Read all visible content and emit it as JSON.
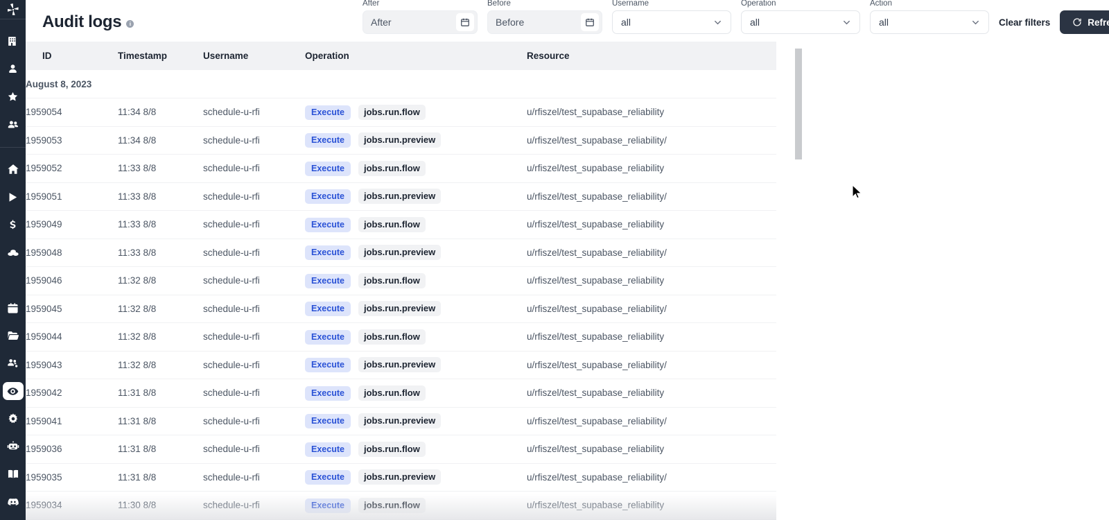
{
  "sidebar": {
    "logo": {
      "icon": "windmill-logo-icon",
      "name": "Windmill"
    },
    "top_items": [
      {
        "icon": "building-icon",
        "label": "Workspace"
      },
      {
        "icon": "person-icon",
        "label": "User"
      },
      {
        "icon": "star-icon",
        "label": "Favorites"
      },
      {
        "icon": "users-group-icon",
        "label": "Groups"
      }
    ],
    "main_items": [
      {
        "icon": "home-icon",
        "label": "Home"
      },
      {
        "icon": "play-icon",
        "label": "Runs"
      },
      {
        "icon": "dollar-icon",
        "label": "Usage"
      },
      {
        "icon": "variables-icon",
        "label": "Variables"
      }
    ],
    "lower_items": [
      {
        "icon": "calendar-icon",
        "label": "Schedules"
      },
      {
        "icon": "folder-icon",
        "label": "Folders"
      },
      {
        "icon": "user-settings-icon",
        "label": "Users & groups"
      },
      {
        "icon": "eye-icon",
        "label": "Audit logs",
        "active": true
      },
      {
        "icon": "gear-icon",
        "label": "Settings"
      },
      {
        "icon": "robot-icon",
        "label": "Workers"
      }
    ],
    "bottom_items": [
      {
        "icon": "book-icon",
        "label": "Docs"
      },
      {
        "icon": "discord-icon",
        "label": "Discord"
      }
    ]
  },
  "header": {
    "title": "Audit logs",
    "info_glyph": "i"
  },
  "filters": {
    "after": {
      "label": "After",
      "placeholder": "After",
      "value": "",
      "calendar_icon": "calendar-icon"
    },
    "before": {
      "label": "Before",
      "placeholder": "Before",
      "value": "",
      "calendar_icon": "calendar-icon"
    },
    "username": {
      "label": "Username",
      "value": "all",
      "options": [
        "all"
      ]
    },
    "operation": {
      "label": "Operation",
      "value": "all",
      "options": [
        "all"
      ]
    },
    "action": {
      "label": "Action",
      "value": "all",
      "options": [
        "all"
      ]
    },
    "clear_label": "Clear filters",
    "refresh_label": "Refresh",
    "refresh_icon": "refresh-icon"
  },
  "table": {
    "columns": [
      "ID",
      "Timestamp",
      "Username",
      "Operation",
      "Resource"
    ],
    "date_group": "August 8, 2023",
    "rows": [
      {
        "id": "1959054",
        "timestamp": "11:34 8/8",
        "username": "schedule-u-rfi",
        "action": "Execute",
        "operation": "jobs.run.flow",
        "resource": "u/rfiszel/test_supabase_reliability"
      },
      {
        "id": "1959053",
        "timestamp": "11:34 8/8",
        "username": "schedule-u-rfi",
        "action": "Execute",
        "operation": "jobs.run.preview",
        "resource": "u/rfiszel/test_supabase_reliability/"
      },
      {
        "id": "1959052",
        "timestamp": "11:33 8/8",
        "username": "schedule-u-rfi",
        "action": "Execute",
        "operation": "jobs.run.flow",
        "resource": "u/rfiszel/test_supabase_reliability"
      },
      {
        "id": "1959051",
        "timestamp": "11:33 8/8",
        "username": "schedule-u-rfi",
        "action": "Execute",
        "operation": "jobs.run.preview",
        "resource": "u/rfiszel/test_supabase_reliability/"
      },
      {
        "id": "1959049",
        "timestamp": "11:33 8/8",
        "username": "schedule-u-rfi",
        "action": "Execute",
        "operation": "jobs.run.flow",
        "resource": "u/rfiszel/test_supabase_reliability"
      },
      {
        "id": "1959048",
        "timestamp": "11:33 8/8",
        "username": "schedule-u-rfi",
        "action": "Execute",
        "operation": "jobs.run.preview",
        "resource": "u/rfiszel/test_supabase_reliability/"
      },
      {
        "id": "1959046",
        "timestamp": "11:32 8/8",
        "username": "schedule-u-rfi",
        "action": "Execute",
        "operation": "jobs.run.flow",
        "resource": "u/rfiszel/test_supabase_reliability"
      },
      {
        "id": "1959045",
        "timestamp": "11:32 8/8",
        "username": "schedule-u-rfi",
        "action": "Execute",
        "operation": "jobs.run.preview",
        "resource": "u/rfiszel/test_supabase_reliability/"
      },
      {
        "id": "1959044",
        "timestamp": "11:32 8/8",
        "username": "schedule-u-rfi",
        "action": "Execute",
        "operation": "jobs.run.flow",
        "resource": "u/rfiszel/test_supabase_reliability"
      },
      {
        "id": "1959043",
        "timestamp": "11:32 8/8",
        "username": "schedule-u-rfi",
        "action": "Execute",
        "operation": "jobs.run.preview",
        "resource": "u/rfiszel/test_supabase_reliability/"
      },
      {
        "id": "1959042",
        "timestamp": "11:31 8/8",
        "username": "schedule-u-rfi",
        "action": "Execute",
        "operation": "jobs.run.flow",
        "resource": "u/rfiszel/test_supabase_reliability"
      },
      {
        "id": "1959041",
        "timestamp": "11:31 8/8",
        "username": "schedule-u-rfi",
        "action": "Execute",
        "operation": "jobs.run.preview",
        "resource": "u/rfiszel/test_supabase_reliability/"
      },
      {
        "id": "1959036",
        "timestamp": "11:31 8/8",
        "username": "schedule-u-rfi",
        "action": "Execute",
        "operation": "jobs.run.flow",
        "resource": "u/rfiszel/test_supabase_reliability"
      },
      {
        "id": "1959035",
        "timestamp": "11:31 8/8",
        "username": "schedule-u-rfi",
        "action": "Execute",
        "operation": "jobs.run.preview",
        "resource": "u/rfiszel/test_supabase_reliability/"
      },
      {
        "id": "1959034",
        "timestamp": "11:30 8/8",
        "username": "schedule-u-rfi",
        "action": "Execute",
        "operation": "jobs.run.flow",
        "resource": "u/rfiszel/test_supabase_reliability"
      }
    ]
  },
  "colors": {
    "sidebar_bg": "#1f2937",
    "accent_badge_bg": "#dde4fb",
    "accent_badge_text": "#2a52d6",
    "header_row_bg": "#f1f2f4",
    "refresh_btn_bg": "#2b3443"
  }
}
